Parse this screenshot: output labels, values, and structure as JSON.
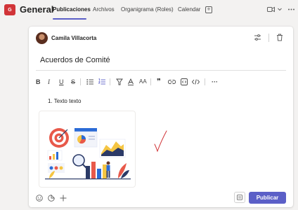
{
  "header": {
    "team_initial": "G",
    "channel_name": "General",
    "tabs": [
      {
        "label": "Publicaciones",
        "active": true
      },
      {
        "label": "Archivos",
        "active": false
      },
      {
        "label": "Organigrama (Roles)",
        "active": false
      },
      {
        "label": "Calendar",
        "active": false
      }
    ],
    "icons": [
      "add-tab-icon",
      "video-icon",
      "chevron-down-icon",
      "more-icon"
    ]
  },
  "composer": {
    "author": "Camila Villacorta",
    "subject": "Acuerdos de Comité",
    "toolbar_icons": [
      "bold",
      "italic",
      "underline",
      "strikethrough",
      "bulleted-list",
      "numbered-list",
      "highlight",
      "font-color",
      "font-size",
      "quote",
      "link",
      "inline-code",
      "code-block",
      "more"
    ],
    "toolbar_glyphs": {
      "bold": "B",
      "italic": "I",
      "underline": "U",
      "strike": "S",
      "font_size": "AA",
      "quote": "❞",
      "more": "···"
    },
    "list_items": [
      "1. Texto texto"
    ],
    "publish_label": "Publicar",
    "colors": {
      "accent": "#5b5fc7",
      "team_avatar": "#d13438",
      "check": "#d13438"
    }
  }
}
